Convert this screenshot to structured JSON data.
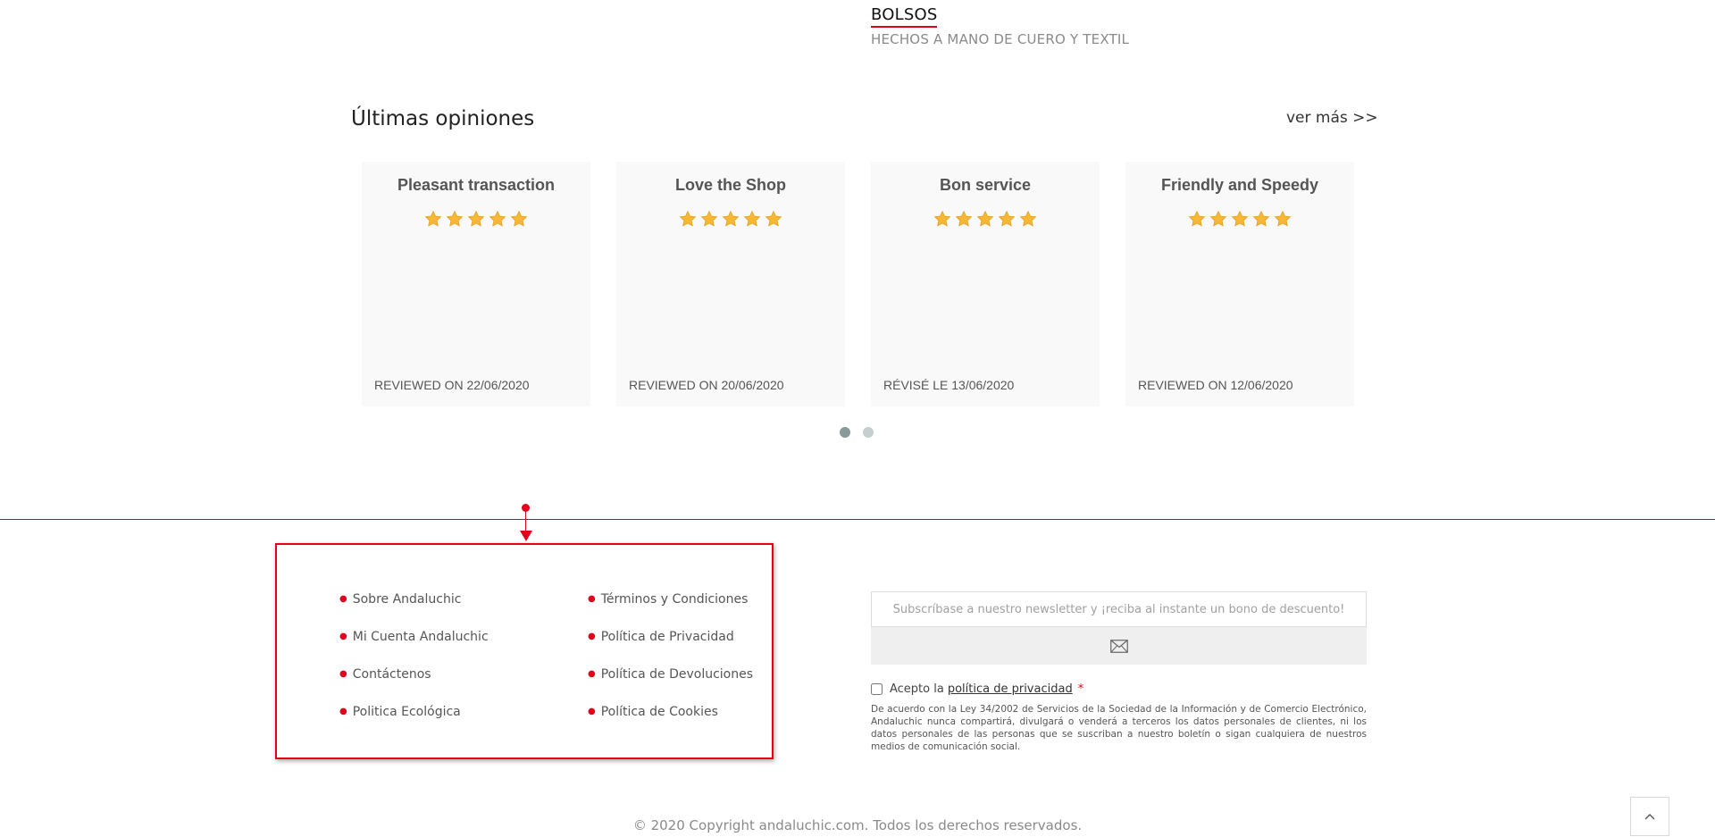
{
  "category": {
    "title": "BOLSOS",
    "subtitle": "HECHOS A MANO DE CUERO Y TEXTIL"
  },
  "reviews": {
    "title": "Últimas opiniones",
    "see_more": "ver más >>",
    "cards": [
      {
        "title": "Pleasant transaction",
        "rating": 5,
        "date": "REVIEWED ON 22/06/2020"
      },
      {
        "title": "Love the Shop",
        "rating": 5,
        "date": "REVIEWED ON 20/06/2020"
      },
      {
        "title": "Bon service",
        "rating": 5,
        "date": "RÉVISÉ LE 13/06/2020"
      },
      {
        "title": "Friendly and Speedy",
        "rating": 5,
        "date": "REVIEWED ON 12/06/2020"
      }
    ],
    "carousel": {
      "pages": 2,
      "active": 1
    }
  },
  "footer": {
    "links_col1": [
      "Sobre Andaluchic",
      "Mi Cuenta Andaluchic",
      "Contáctenos",
      "Politica Ecológica"
    ],
    "links_col2": [
      "Términos y Condiciones",
      "Política de Privacidad",
      "Política de Devoluciones",
      "Política de Cookies"
    ],
    "newsletter": {
      "placeholder": "Subscríbase a nuestro newsletter y ¡reciba al instante un bono de descuento!",
      "button_icon": "envelope-icon",
      "consent_prefix": "Acepto la",
      "consent_link": "política de privacidad",
      "required_mark": "*",
      "legal_text": "De acuerdo con la Ley 34/2002 de Servicios de la Sociedad de la Información y de Comercio Electrónico, Andaluchic nunca compartirá, divulgará o venderá a terceros los datos personales de clientes, ni los datos personales de las personas que se suscriban a nuestro boletín o sigan cualquiera de nuestros medios de comunicación social."
    },
    "copyright": "© 2020 Copyright andaluchic.com. Todos los derechos reservados.",
    "back_to_top_icon": "chevron-up-icon"
  },
  "colors": {
    "accent": "#e3001b",
    "star": "#f7b733",
    "card_bg": "#f9f9f9"
  }
}
